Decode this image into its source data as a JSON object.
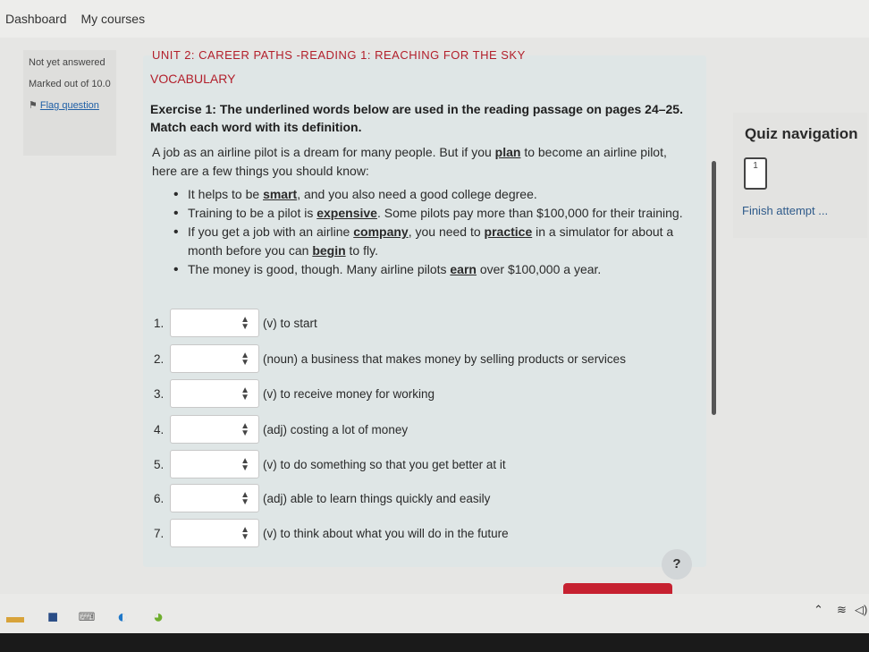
{
  "nav": {
    "dashboard": "Dashboard",
    "courses": "My courses"
  },
  "question_info": {
    "status": "Not yet answered",
    "marks": "Marked out of 10.0",
    "flag": "Flag question"
  },
  "unit_title": "UNIT 2: CAREER PATHS -READING 1: REACHING FOR THE SKY",
  "section": "VOCABULARY",
  "exercise": {
    "line1": "Exercise 1: The underlined words below are used in the reading passage on pages 24–25.",
    "line2": "Match each word with its definition."
  },
  "intro": {
    "a": "A job as an airline pilot is a dream for many people. But if you ",
    "plan": "plan",
    "b": " to become an airline pilot, here are a few things you should know:"
  },
  "bullets": [
    {
      "a": "It helps to be ",
      "w": "smart",
      "b": ", and you also need a good college degree."
    },
    {
      "a": "Training to be a pilot is ",
      "w": "expensive",
      "b": ". Some pilots pay more than $100,000 for their training."
    },
    {
      "a": "If you get a job with an airline ",
      "w": "company",
      "b": ", you need to ",
      "w2": "practice",
      "c": " in a simulator for about a month before you can ",
      "w3": "begin",
      "d": " to fly."
    },
    {
      "a": "The money is good, though. Many airline pilots ",
      "w": "earn",
      "b": " over $100,000 a year."
    }
  ],
  "items": [
    {
      "num": "1.",
      "def": "(v) to start"
    },
    {
      "num": "2.",
      "def": "(noun) a business that makes money by selling products or services"
    },
    {
      "num": "3.",
      "def": "(v) to receive money for working"
    },
    {
      "num": "4.",
      "def": "(adj) costing a lot of money"
    },
    {
      "num": "5.",
      "def": "(v) to do something so that you get better at it"
    },
    {
      "num": "6.",
      "def": "(adj) able to learn things quickly and easily"
    },
    {
      "num": "7.",
      "def": "(v) to think about what you will do in the future"
    }
  ],
  "quiz_nav": {
    "title": "Quiz navigation",
    "q1": "1",
    "finish": "Finish attempt ..."
  },
  "help": "?"
}
